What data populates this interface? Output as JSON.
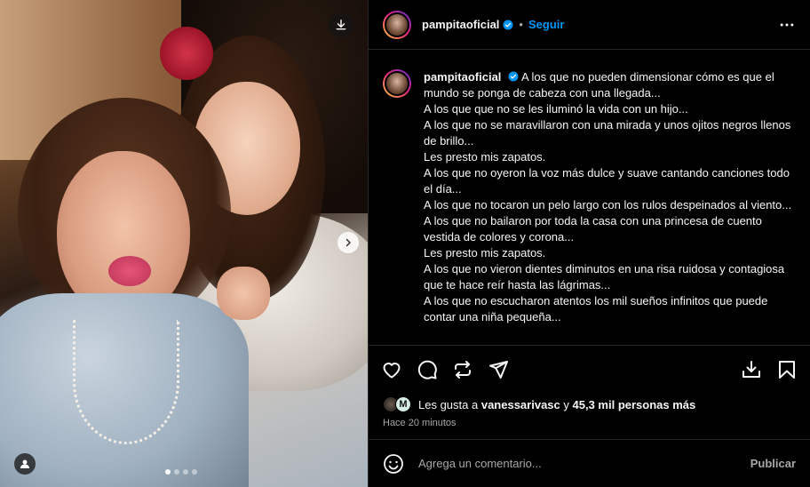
{
  "colors": {
    "background": "#000000",
    "accent": "#0095f6",
    "muted": "#a8a8a8",
    "border": "#262626"
  },
  "media": {
    "download_icon": "download-icon",
    "next_icon": "chevron-right-icon",
    "user_tag_icon": "user-icon",
    "carousel": {
      "total": 4,
      "active": 1
    }
  },
  "header": {
    "username": "pampitaoficial",
    "separator": "•",
    "follow_label": "Seguir",
    "more_icon": "more-horizontal-icon"
  },
  "caption": {
    "username": "pampitaoficial",
    "lines": [
      "A los que no pueden dimensionar cómo es que el mundo se ponga de cabeza con una llegada...",
      "A los que que no se les iluminó la vida con un hijo...",
      "A los que no se maravillaron con una mirada y unos ojitos negros llenos de brillo...",
      "Les presto mis zapatos.",
      "A los que no oyeron la voz más dulce y suave cantando canciones todo el día...",
      "A los que no tocaron un pelo largo con los rulos despeinados al viento...",
      "A los que no bailaron por toda la casa con una princesa de cuento vestida de colores y corona...",
      "Les presto mis zapatos.",
      "A los que no vieron dientes diminutos en una risa ruidosa y contagiosa que te hace reír hasta las lágrimas...",
      "A los que no escucharon atentos los mil sueños infinitos que puede contar una niña pequeña..."
    ]
  },
  "actions": {
    "like_icon": "heart-icon",
    "comment_icon": "comment-icon",
    "repost_icon": "repost-icon",
    "share_icon": "send-icon",
    "save_download_icon": "download-icon",
    "bookmark_icon": "bookmark-icon"
  },
  "likes": {
    "prefix": "Les gusta a",
    "user": "vanessarivasc",
    "connector": "y",
    "others": "45,3 mil personas más",
    "avatar_letter": "M"
  },
  "time": "Hace 20 minutos",
  "comment": {
    "emoji_icon": "emoji-icon",
    "placeholder": "Agrega un comentario...",
    "post_label": "Publicar"
  }
}
